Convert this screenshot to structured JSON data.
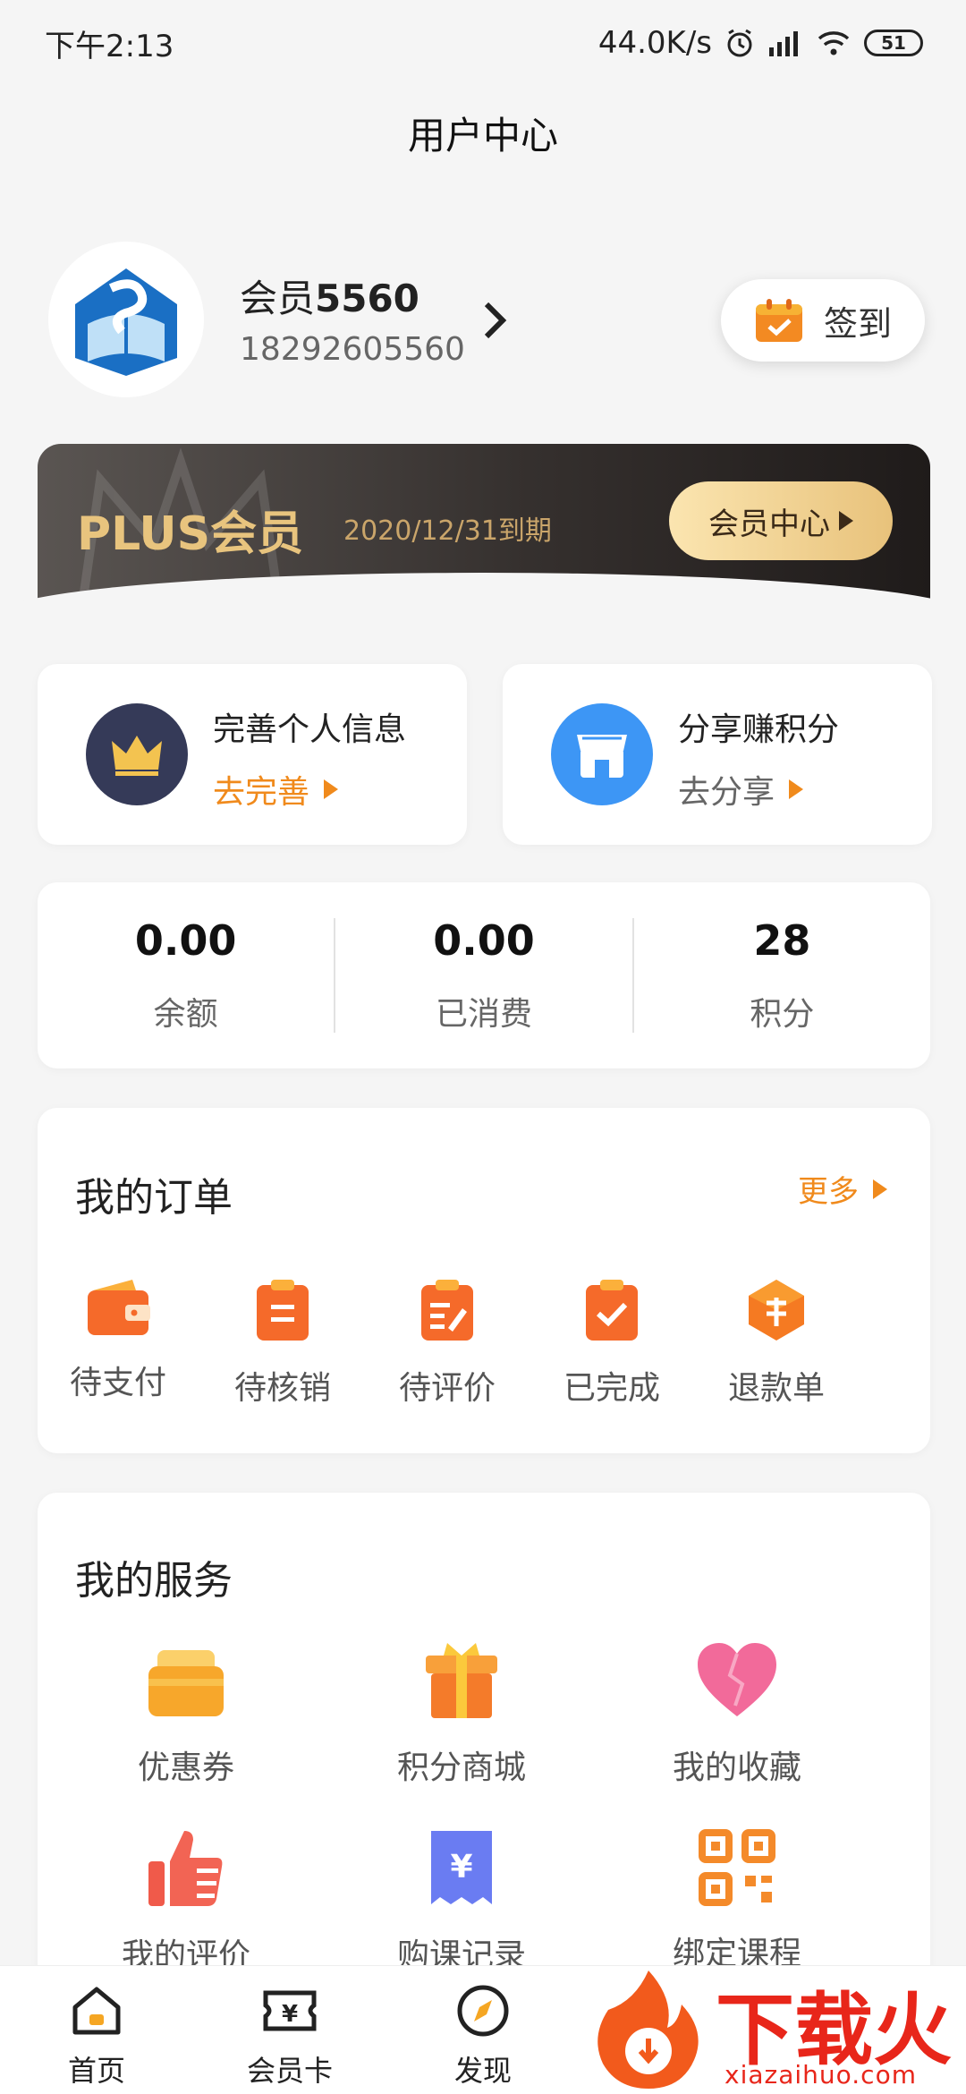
{
  "status": {
    "time": "下午2:13",
    "speed": "44.0K/s",
    "battery": "51"
  },
  "header": {
    "title": "用户中心"
  },
  "profile": {
    "name_prefix": "会员",
    "name_number": "5560",
    "phone": "18292605560",
    "signin_label": "签到"
  },
  "plus": {
    "title": "PLUS会员",
    "expiry": "2020/12/31到期",
    "button_label": "会员中心"
  },
  "quick_cards": [
    {
      "title": "完善个人信息",
      "link": "去完善",
      "icon": "crown-icon",
      "color": "#f08a1c"
    },
    {
      "title": "分享赚积分",
      "link": "去分享",
      "icon": "shop-icon",
      "color": "#666666"
    }
  ],
  "stats": [
    {
      "value": "0.00",
      "label": "余额"
    },
    {
      "value": "0.00",
      "label": "已消费"
    },
    {
      "value": "28",
      "label": "积分"
    }
  ],
  "orders": {
    "title": "我的订单",
    "more": "更多",
    "items": [
      "待支付",
      "待核销",
      "待评价",
      "已完成",
      "退款单"
    ]
  },
  "services": {
    "title": "我的服务",
    "items": [
      "优惠券",
      "积分商城",
      "我的收藏",
      "我的评价",
      "购课记录",
      "绑定课程"
    ]
  },
  "tabs": [
    "首页",
    "会员卡",
    "发现"
  ],
  "watermark": {
    "brand": "下载火",
    "domain": "xiazaihuo.com"
  }
}
